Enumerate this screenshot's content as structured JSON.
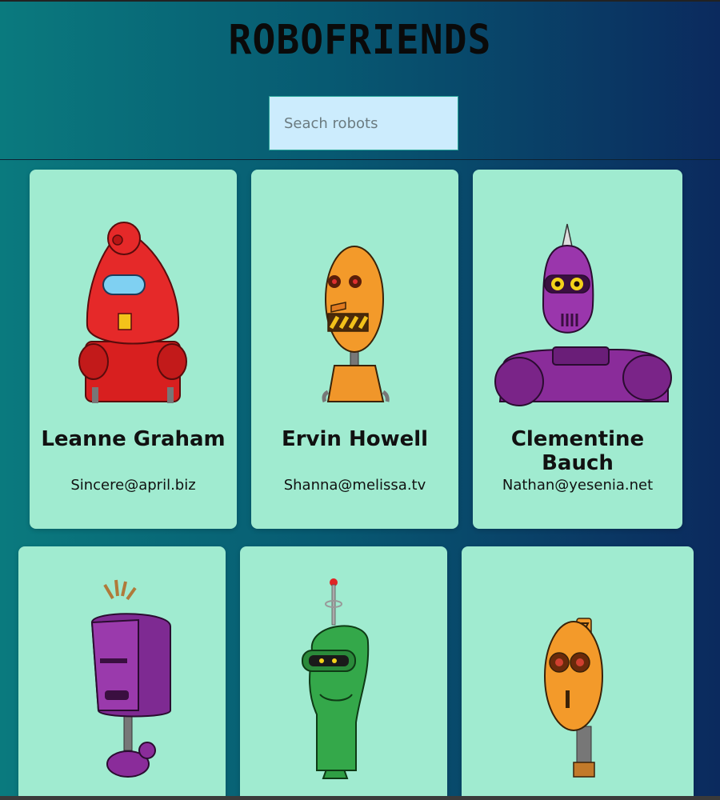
{
  "app": {
    "title": "ROBOFRIENDS"
  },
  "search": {
    "placeholder": "Seach robots",
    "value": ""
  },
  "robots": [
    {
      "name": "Leanne Graham",
      "email": "Sincere@april.biz",
      "color": "#e02424"
    },
    {
      "name": "Ervin Howell",
      "email": "Shanna@melissa.tv",
      "color": "#f39a2a"
    },
    {
      "name": "Clementine Bauch",
      "email": "Nathan@yesenia.net",
      "color": "#8a2c9a"
    },
    {
      "name": "",
      "email": "",
      "color": "#7e2a92"
    },
    {
      "name": "",
      "email": "",
      "color": "#2f9e44"
    },
    {
      "name": "",
      "email": "",
      "color": "#f39a2a"
    }
  ],
  "colors": {
    "card_bg": "#a0ebd0",
    "search_bg": "#ccecfd"
  }
}
